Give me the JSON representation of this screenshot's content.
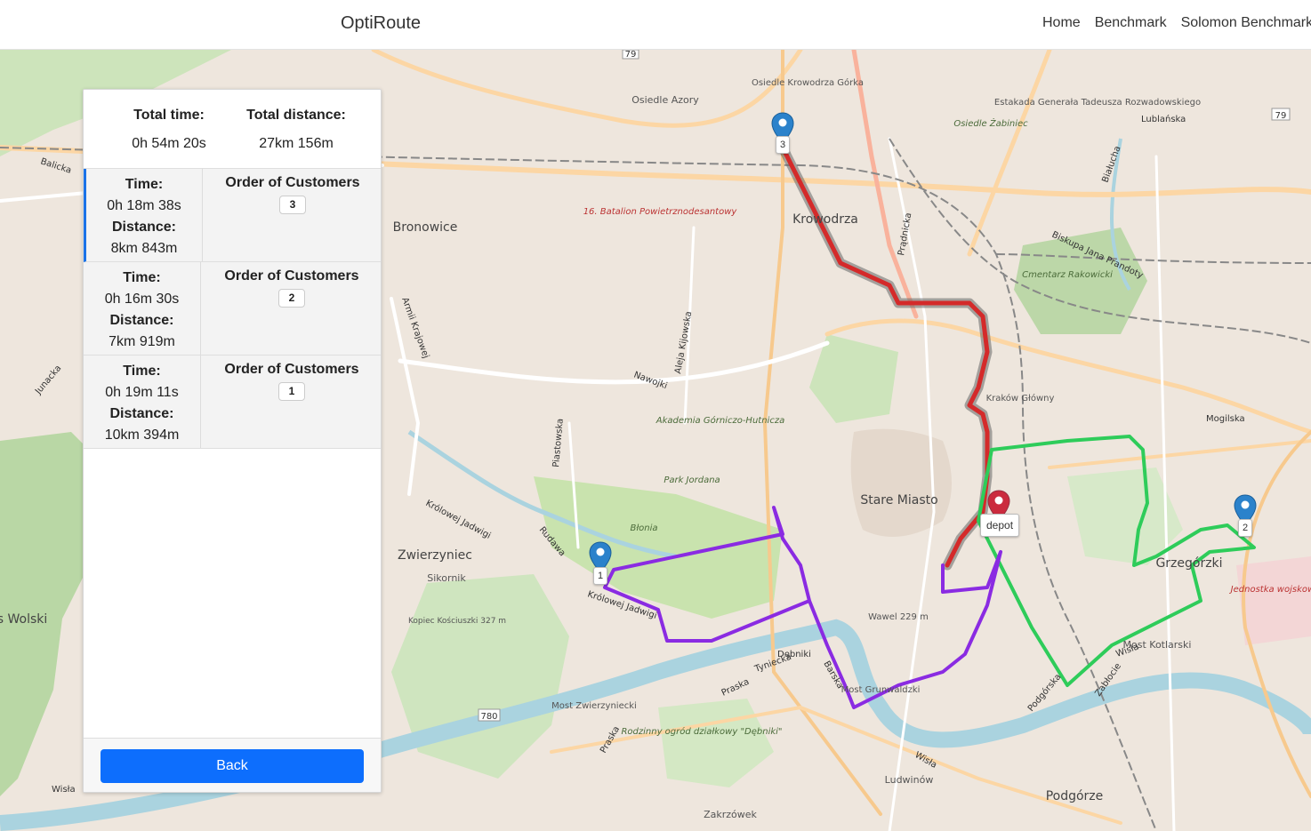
{
  "navbar": {
    "brand": "OptiRoute",
    "links": [
      "Home",
      "Benchmark",
      "Solomon Benchmark"
    ]
  },
  "summary": {
    "total_time_label": "Total time:",
    "total_time_value": "0h 54m 20s",
    "total_distance_label": "Total distance:",
    "total_distance_value": "27km 156m"
  },
  "routes": [
    {
      "time_label": "Time:",
      "time": "0h 18m 38s",
      "distance_label": "Distance:",
      "distance": "8km 843m",
      "order_label": "Order of Customers",
      "customers": "3",
      "color": "#d42a2a"
    },
    {
      "time_label": "Time:",
      "time": "0h 16m 30s",
      "distance_label": "Distance:",
      "distance": "7km 919m",
      "order_label": "Order of Customers",
      "customers": "2",
      "color": "#2ecc5a"
    },
    {
      "time_label": "Time:",
      "time": "0h 19m 11s",
      "distance_label": "Distance:",
      "distance": "10km 394m",
      "order_label": "Order of Customers",
      "customers": "1",
      "color": "#8a2be2"
    }
  ],
  "back_button": "Back",
  "map": {
    "markers": [
      {
        "label": "3",
        "icon": "map-pin-blue"
      },
      {
        "label": "2",
        "icon": "map-pin-blue"
      },
      {
        "label": "1",
        "icon": "map-pin-blue"
      },
      {
        "label": "depot",
        "icon": "map-pin-red"
      }
    ],
    "place_labels": {
      "osiedle_azory": "Osiedle Azory",
      "osiedle_krowodrza": "Osiedle Krowodrza Górka",
      "batalion": "16. Batalion Powietrznodesantowy",
      "bronowice": "Bronowice",
      "krowodrza": "Krowodrza",
      "estakada": "Estakada Generała Tadeusza Rozwadowskiego",
      "zabiniec": "Osiedle Żabiniec",
      "cmentarz": "Cmentarz Rakowicki",
      "krakow_glowny": "Kraków Główny",
      "akademia": "Akademia Górniczo-Hutnicza",
      "park_jordana": "Park Jordana",
      "blonia": "Błonia",
      "stare_miasto": "Stare Miasto",
      "zwierzyniec": "Zwierzyniec",
      "sikornik": "Sikornik",
      "kopiec": "Kopiec Kościuszki 327 m",
      "wawel": "Wawel 229 m",
      "grzegorzki": "Grzegórzki",
      "jednostka": "Jednostka wojskowa",
      "most_kotlarski": "Most Kotlarski",
      "most_grunwaldzki": "Most Grunwaldzki",
      "most_zwierzyniecki": "Most Zwierzyniecki",
      "ludwinow": "Ludwinów",
      "podgorze": "Podgórze",
      "zakrzowek": "Zakrzówek",
      "ogrod": "Rodzinny ogród działkowy \"Dębniki\"",
      "wolski": "s Wolski"
    },
    "street_labels": {
      "balicka": "Balicka",
      "nawojki": "Nawojki",
      "armii_krajowej": "Armii Krajowej",
      "krolowej_jadwigi": "Królowej Jadwigi",
      "tyniecka": "Tyniecka",
      "barska": "Barska",
      "debniki": "Dębniki",
      "praska": "Praska",
      "wisla": "Wisła",
      "podgorska": "Podgórska",
      "zablocie": "Zabłocie",
      "mogilska": "Mogilska",
      "lublanska": "Lublańska",
      "pradnicka": "Prądnicka",
      "biskupa": "Biskupa Jana Prandoty",
      "bialucha": "Białucha",
      "rudawa": "Rudawa",
      "piastowska": "Piastowska",
      "kijowska": "Aleja Kijowska",
      "junacka": "Junacka",
      "road_79": "79",
      "road_780": "780"
    }
  }
}
